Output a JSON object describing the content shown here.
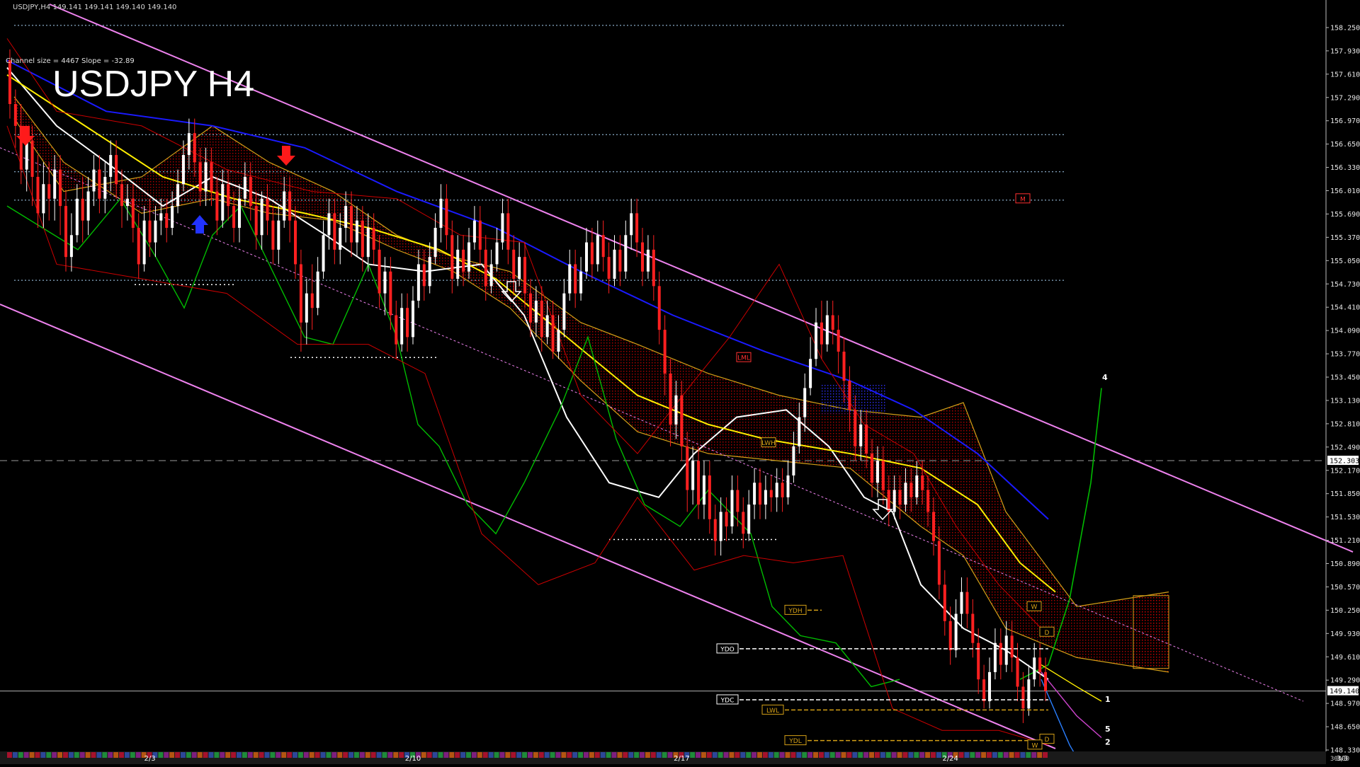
{
  "header": {
    "symbol_line": "USDJPY,H4  149.141 149.141 149.140 149.140",
    "channel_info": "Channel size = 4467 Slope = -32.89",
    "watermark": "USDJPY H4"
  },
  "colors": {
    "background": "#000000",
    "bull_candle": "#ffffff",
    "bear_candle": "#ff2020",
    "channel": "#ee82ee",
    "ma_white": "#ffffff",
    "ma_yellow": "#ffee00",
    "ma_blue": "#1a1aff",
    "chikou_green": "#00bb00",
    "bollinger_red": "#cc0000",
    "cloud_red": "#cc0000",
    "cloud_orange": "#d4a017",
    "level_dotted": "#a9d3f5"
  },
  "chart_data": {
    "type": "candlestick",
    "symbol": "USDJPY",
    "timeframe": "H4",
    "ylim": [
      148.33,
      158.57
    ],
    "price_ticks": [
      "158.250",
      "157.930",
      "157.610",
      "157.290",
      "156.970",
      "156.650",
      "156.330",
      "156.010",
      "155.690",
      "155.370",
      "155.050",
      "154.730",
      "154.410",
      "154.090",
      "153.770",
      "153.450",
      "153.130",
      "152.810",
      "152.490",
      "152.170",
      "151.850",
      "151.530",
      "151.210",
      "150.890",
      "150.570",
      "150.250",
      "149.930",
      "149.610",
      "149.290",
      "148.970",
      "148.650",
      "148.330"
    ],
    "date_labels": [
      {
        "label": "2/3",
        "bar": 25
      },
      {
        "label": "2/10",
        "bar": 72
      },
      {
        "label": "2/17",
        "bar": 120
      },
      {
        "label": "2/24",
        "bar": 168
      },
      {
        "label": "3/3",
        "bar": 238
      }
    ],
    "current_price": "149.140",
    "marker_price": "152.303",
    "volume_label": "30000",
    "levels": [
      {
        "name": "YDH",
        "price": 150.25
      },
      {
        "name": "YDO",
        "price": 149.72
      },
      {
        "name": "YDC",
        "price": 149.02
      },
      {
        "name": "LWL",
        "price": 148.88
      },
      {
        "name": "YDL",
        "price": 148.46
      }
    ],
    "indicator_tags": [
      "LML",
      "LWH",
      "W",
      "D",
      "D",
      "W",
      "M"
    ],
    "projection_labels": [
      "1",
      "2",
      "4",
      "5"
    ],
    "candles": [
      [
        157.8,
        157.2,
        157.95,
        157.0
      ],
      [
        157.2,
        156.9,
        157.4,
        156.6
      ],
      [
        156.9,
        156.3,
        157.2,
        156.1
      ],
      [
        156.3,
        156.7,
        156.9,
        156.0
      ],
      [
        156.7,
        156.2,
        156.9,
        155.8
      ],
      [
        156.2,
        155.7,
        156.5,
        155.5
      ],
      [
        155.7,
        156.1,
        156.4,
        155.5
      ],
      [
        156.1,
        155.9,
        156.4,
        155.6
      ],
      [
        155.9,
        156.3,
        156.5,
        155.6
      ],
      [
        156.3,
        155.8,
        156.5,
        155.4
      ],
      [
        155.8,
        155.1,
        156.0,
        154.9
      ],
      [
        155.1,
        155.4,
        155.7,
        154.9
      ],
      [
        155.4,
        155.9,
        156.1,
        155.3
      ],
      [
        155.9,
        155.6,
        156.2,
        155.3
      ],
      [
        155.6,
        156.0,
        156.2,
        155.4
      ],
      [
        156.0,
        156.3,
        156.5,
        155.8
      ],
      [
        156.3,
        155.9,
        156.5,
        155.7
      ],
      [
        155.9,
        156.2,
        156.4,
        155.7
      ],
      [
        156.2,
        156.5,
        156.7,
        156.0
      ],
      [
        156.5,
        156.1,
        156.7,
        155.9
      ],
      [
        156.1,
        155.8,
        156.3,
        155.5
      ],
      [
        155.8,
        155.9,
        156.1,
        155.6
      ],
      [
        155.9,
        155.5,
        156.1,
        155.3
      ],
      [
        155.5,
        155.0,
        155.7,
        154.8
      ],
      [
        155.0,
        155.6,
        155.8,
        154.9
      ],
      [
        155.6,
        155.3,
        155.9,
        155.1
      ],
      [
        155.3,
        155.6,
        155.8,
        155.1
      ],
      [
        155.6,
        155.7,
        155.9,
        155.4
      ],
      [
        155.7,
        155.5,
        155.9,
        155.3
      ],
      [
        155.5,
        155.8,
        156.0,
        155.4
      ],
      [
        155.8,
        156.1,
        156.3,
        155.7
      ],
      [
        156.1,
        156.5,
        156.7,
        156.0
      ],
      [
        156.5,
        156.8,
        157.0,
        156.3
      ],
      [
        156.8,
        156.4,
        157.0,
        156.2
      ],
      [
        156.4,
        156.0,
        156.6,
        155.8
      ],
      [
        156.0,
        156.4,
        156.6,
        155.8
      ],
      [
        156.4,
        156.0,
        156.6,
        155.8
      ],
      [
        156.0,
        155.6,
        156.2,
        155.4
      ],
      [
        155.6,
        156.1,
        156.3,
        155.5
      ],
      [
        156.1,
        155.8,
        156.3,
        155.6
      ],
      [
        155.8,
        155.5,
        156.0,
        155.3
      ],
      [
        155.5,
        155.9,
        156.1,
        155.3
      ],
      [
        155.9,
        156.2,
        156.4,
        155.8
      ],
      [
        156.2,
        155.8,
        156.4,
        155.6
      ],
      [
        155.8,
        155.4,
        156.0,
        155.2
      ],
      [
        155.4,
        155.9,
        156.0,
        155.2
      ],
      [
        155.9,
        155.6,
        156.1,
        155.4
      ],
      [
        155.6,
        155.2,
        155.8,
        155.0
      ],
      [
        155.2,
        155.6,
        155.8,
        155.0
      ],
      [
        155.6,
        156.0,
        156.2,
        155.5
      ],
      [
        156.0,
        155.6,
        156.2,
        155.3
      ],
      [
        155.6,
        155.0,
        155.8,
        154.8
      ],
      [
        155.0,
        154.2,
        155.2,
        153.8
      ],
      [
        154.2,
        154.6,
        154.8,
        153.9
      ],
      [
        154.6,
        154.4,
        155.0,
        154.1
      ],
      [
        154.4,
        154.9,
        155.1,
        154.3
      ],
      [
        154.9,
        155.4,
        155.6,
        154.8
      ],
      [
        155.4,
        155.7,
        155.9,
        155.2
      ],
      [
        155.7,
        155.2,
        155.9,
        155.0
      ],
      [
        155.2,
        155.5,
        155.7,
        155.0
      ],
      [
        155.5,
        155.8,
        156.0,
        155.3
      ],
      [
        155.8,
        155.3,
        156.0,
        155.1
      ],
      [
        155.3,
        155.6,
        155.8,
        155.1
      ],
      [
        155.6,
        155.1,
        155.8,
        154.9
      ],
      [
        155.1,
        155.5,
        155.7,
        154.9
      ],
      [
        155.5,
        155.2,
        155.7,
        155.0
      ],
      [
        155.2,
        154.6,
        155.4,
        154.4
      ],
      [
        154.6,
        154.9,
        155.1,
        154.3
      ],
      [
        154.9,
        154.3,
        155.1,
        154.1
      ],
      [
        154.3,
        153.9,
        154.5,
        153.7
      ],
      [
        153.9,
        154.4,
        154.6,
        153.8
      ],
      [
        154.4,
        154.0,
        154.6,
        153.8
      ],
      [
        154.0,
        154.5,
        154.7,
        153.9
      ],
      [
        154.5,
        155.0,
        155.2,
        154.4
      ],
      [
        155.0,
        154.7,
        155.2,
        154.5
      ],
      [
        154.7,
        155.1,
        155.3,
        154.6
      ],
      [
        155.1,
        155.5,
        155.7,
        155.0
      ],
      [
        155.5,
        155.9,
        156.1,
        155.3
      ],
      [
        155.9,
        155.4,
        156.1,
        155.2
      ],
      [
        155.4,
        154.8,
        155.6,
        154.6
      ],
      [
        154.8,
        155.2,
        155.4,
        154.7
      ],
      [
        155.2,
        154.9,
        155.4,
        154.7
      ],
      [
        154.9,
        155.3,
        155.5,
        154.8
      ],
      [
        155.3,
        155.6,
        155.8,
        155.2
      ],
      [
        155.6,
        155.2,
        155.8,
        155.0
      ],
      [
        155.2,
        154.7,
        155.4,
        154.5
      ],
      [
        154.7,
        155.0,
        155.2,
        154.6
      ],
      [
        155.0,
        155.3,
        155.5,
        154.9
      ],
      [
        155.3,
        155.7,
        155.9,
        155.2
      ],
      [
        155.7,
        155.2,
        155.9,
        155.0
      ],
      [
        155.2,
        154.8,
        155.4,
        154.6
      ],
      [
        154.8,
        155.1,
        155.3,
        154.7
      ],
      [
        155.1,
        154.6,
        155.3,
        154.4
      ],
      [
        154.6,
        154.2,
        154.8,
        154.0
      ],
      [
        154.2,
        154.5,
        154.7,
        154.0
      ],
      [
        154.5,
        154.0,
        154.7,
        153.8
      ],
      [
        154.0,
        154.3,
        154.5,
        153.9
      ],
      [
        154.3,
        153.8,
        154.5,
        153.7
      ],
      [
        153.8,
        154.1,
        154.3,
        153.7
      ],
      [
        154.1,
        154.6,
        154.8,
        154.0
      ],
      [
        154.6,
        155.0,
        155.2,
        154.5
      ],
      [
        155.0,
        154.6,
        155.2,
        154.4
      ],
      [
        154.6,
        154.9,
        155.1,
        154.5
      ],
      [
        154.9,
        155.3,
        155.5,
        154.8
      ],
      [
        155.3,
        155.0,
        155.5,
        154.8
      ],
      [
        155.0,
        155.4,
        155.6,
        154.9
      ],
      [
        155.4,
        155.1,
        155.6,
        154.9
      ],
      [
        155.1,
        154.8,
        155.3,
        154.6
      ],
      [
        154.8,
        155.2,
        155.4,
        154.7
      ],
      [
        155.2,
        154.9,
        155.4,
        154.7
      ],
      [
        154.9,
        155.4,
        155.6,
        154.8
      ],
      [
        155.4,
        155.7,
        155.9,
        155.2
      ],
      [
        155.7,
        155.3,
        155.9,
        155.1
      ],
      [
        155.3,
        154.9,
        155.5,
        154.7
      ],
      [
        154.9,
        155.2,
        155.4,
        154.8
      ],
      [
        155.2,
        154.7,
        155.4,
        154.5
      ],
      [
        154.7,
        154.1,
        154.9,
        153.9
      ],
      [
        154.1,
        153.5,
        154.3,
        153.2
      ],
      [
        153.5,
        152.8,
        153.7,
        152.5
      ],
      [
        152.8,
        153.2,
        153.4,
        152.6
      ],
      [
        153.2,
        152.5,
        153.4,
        152.3
      ],
      [
        152.5,
        151.9,
        152.7,
        151.6
      ],
      [
        151.9,
        152.3,
        152.5,
        151.7
      ],
      [
        152.3,
        151.7,
        152.5,
        151.5
      ],
      [
        151.7,
        152.1,
        152.3,
        151.5
      ],
      [
        152.1,
        151.5,
        152.3,
        151.3
      ],
      [
        151.5,
        151.2,
        151.7,
        151.0
      ],
      [
        151.2,
        151.6,
        151.8,
        151.0
      ],
      [
        151.6,
        151.4,
        151.8,
        151.2
      ],
      [
        151.4,
        151.9,
        152.1,
        151.3
      ],
      [
        151.9,
        151.6,
        152.1,
        151.4
      ],
      [
        151.6,
        151.3,
        151.8,
        151.1
      ],
      [
        151.3,
        151.7,
        151.9,
        151.2
      ],
      [
        151.7,
        152.0,
        152.2,
        151.5
      ],
      [
        152.0,
        151.7,
        152.2,
        151.5
      ],
      [
        151.7,
        151.9,
        152.1,
        151.5
      ],
      [
        151.9,
        151.8,
        152.1,
        151.6
      ],
      [
        151.8,
        152.0,
        152.2,
        151.6
      ],
      [
        152.0,
        151.8,
        152.2,
        151.6
      ],
      [
        151.8,
        152.1,
        152.3,
        151.7
      ],
      [
        152.1,
        152.5,
        152.7,
        152.0
      ],
      [
        152.5,
        152.9,
        153.1,
        152.4
      ],
      [
        152.9,
        153.3,
        153.5,
        152.7
      ],
      [
        153.3,
        153.7,
        154.0,
        153.2
      ],
      [
        153.7,
        154.2,
        154.4,
        153.6
      ],
      [
        154.2,
        153.9,
        154.5,
        153.7
      ],
      [
        153.9,
        154.3,
        154.5,
        153.8
      ],
      [
        154.3,
        154.1,
        154.5,
        153.9
      ],
      [
        154.1,
        153.8,
        154.3,
        153.5
      ],
      [
        153.8,
        153.4,
        154.0,
        153.1
      ],
      [
        153.4,
        153.0,
        153.6,
        152.7
      ],
      [
        153.0,
        152.5,
        153.2,
        152.3
      ],
      [
        152.5,
        152.8,
        153.0,
        152.3
      ],
      [
        152.8,
        152.4,
        153.0,
        152.2
      ],
      [
        152.4,
        152.0,
        152.6,
        151.8
      ],
      [
        152.0,
        152.3,
        152.5,
        151.8
      ],
      [
        152.3,
        151.9,
        152.5,
        151.7
      ],
      [
        151.9,
        151.6,
        152.1,
        151.4
      ],
      [
        151.6,
        151.9,
        152.1,
        151.5
      ],
      [
        151.9,
        151.7,
        152.1,
        151.5
      ],
      [
        151.7,
        152.0,
        152.2,
        151.6
      ],
      [
        152.0,
        151.8,
        152.2,
        151.6
      ],
      [
        151.8,
        152.1,
        152.3,
        151.7
      ],
      [
        152.1,
        151.9,
        152.3,
        151.7
      ],
      [
        151.9,
        151.6,
        152.1,
        151.4
      ],
      [
        151.6,
        151.2,
        151.8,
        151.0
      ],
      [
        151.2,
        150.6,
        151.4,
        150.4
      ],
      [
        150.6,
        150.1,
        150.8,
        149.9
      ],
      [
        150.1,
        149.7,
        150.3,
        149.5
      ],
      [
        149.7,
        150.2,
        150.4,
        149.6
      ],
      [
        150.2,
        150.5,
        150.7,
        150.0
      ],
      [
        150.5,
        150.2,
        150.7,
        150.0
      ],
      [
        150.2,
        149.8,
        150.4,
        149.6
      ],
      [
        149.8,
        149.3,
        150.0,
        149.1
      ],
      [
        149.3,
        149.0,
        149.5,
        148.9
      ],
      [
        149.0,
        149.4,
        149.6,
        148.9
      ],
      [
        149.4,
        149.8,
        150.0,
        149.3
      ],
      [
        149.8,
        149.5,
        150.0,
        149.3
      ],
      [
        149.5,
        149.9,
        150.1,
        149.4
      ],
      [
        149.9,
        149.6,
        150.1,
        149.4
      ],
      [
        149.6,
        149.2,
        149.8,
        149.0
      ],
      [
        149.2,
        148.9,
        149.4,
        148.7
      ],
      [
        148.9,
        149.3,
        149.5,
        148.8
      ],
      [
        149.3,
        149.6,
        149.8,
        149.2
      ],
      [
        149.6,
        149.4,
        149.8,
        149.2
      ],
      [
        149.4,
        149.14,
        149.6,
        149.0
      ]
    ]
  }
}
